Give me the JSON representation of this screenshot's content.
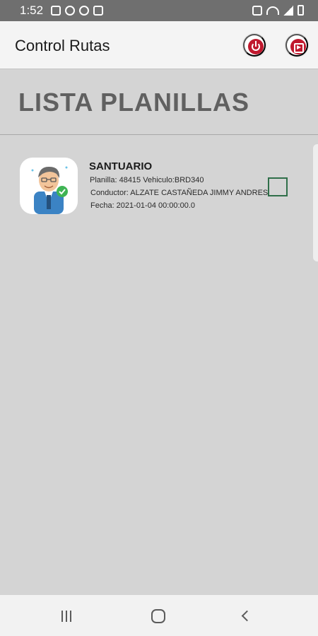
{
  "status_bar": {
    "time": "1:52",
    "left_icons": [
      "image-icon",
      "messenger-icon",
      "whatsapp-icon",
      "youtube-icon"
    ],
    "right_icons": [
      "vibrate-icon",
      "wifi-icon",
      "signal-icon",
      "battery-icon"
    ]
  },
  "app_bar": {
    "title": "Control Rutas",
    "actions": [
      "power-icon",
      "exit-icon"
    ]
  },
  "section": {
    "title": "LISTA PLANILLAS"
  },
  "planillas": [
    {
      "name": "SANTUARIO",
      "planilla_line": "Planilla: 48415 Vehiculo:BRD340",
      "conductor_line": "Conductor: ALZATE CASTAÑEDA JIMMY ANDRES",
      "fecha_line": "Fecha: 2021-01-04 00:00:00.0",
      "checked": false
    }
  ],
  "navigation": {
    "buttons": [
      "recents-icon",
      "home-icon",
      "back-icon"
    ]
  },
  "colors": {
    "status_bar": "#6f6f6f",
    "app_bar": "#f4f4f4",
    "background": "#d4d4d4",
    "accent_red": "#c0192e",
    "header_text": "#606060",
    "checkbox_border": "#2f6f49"
  }
}
